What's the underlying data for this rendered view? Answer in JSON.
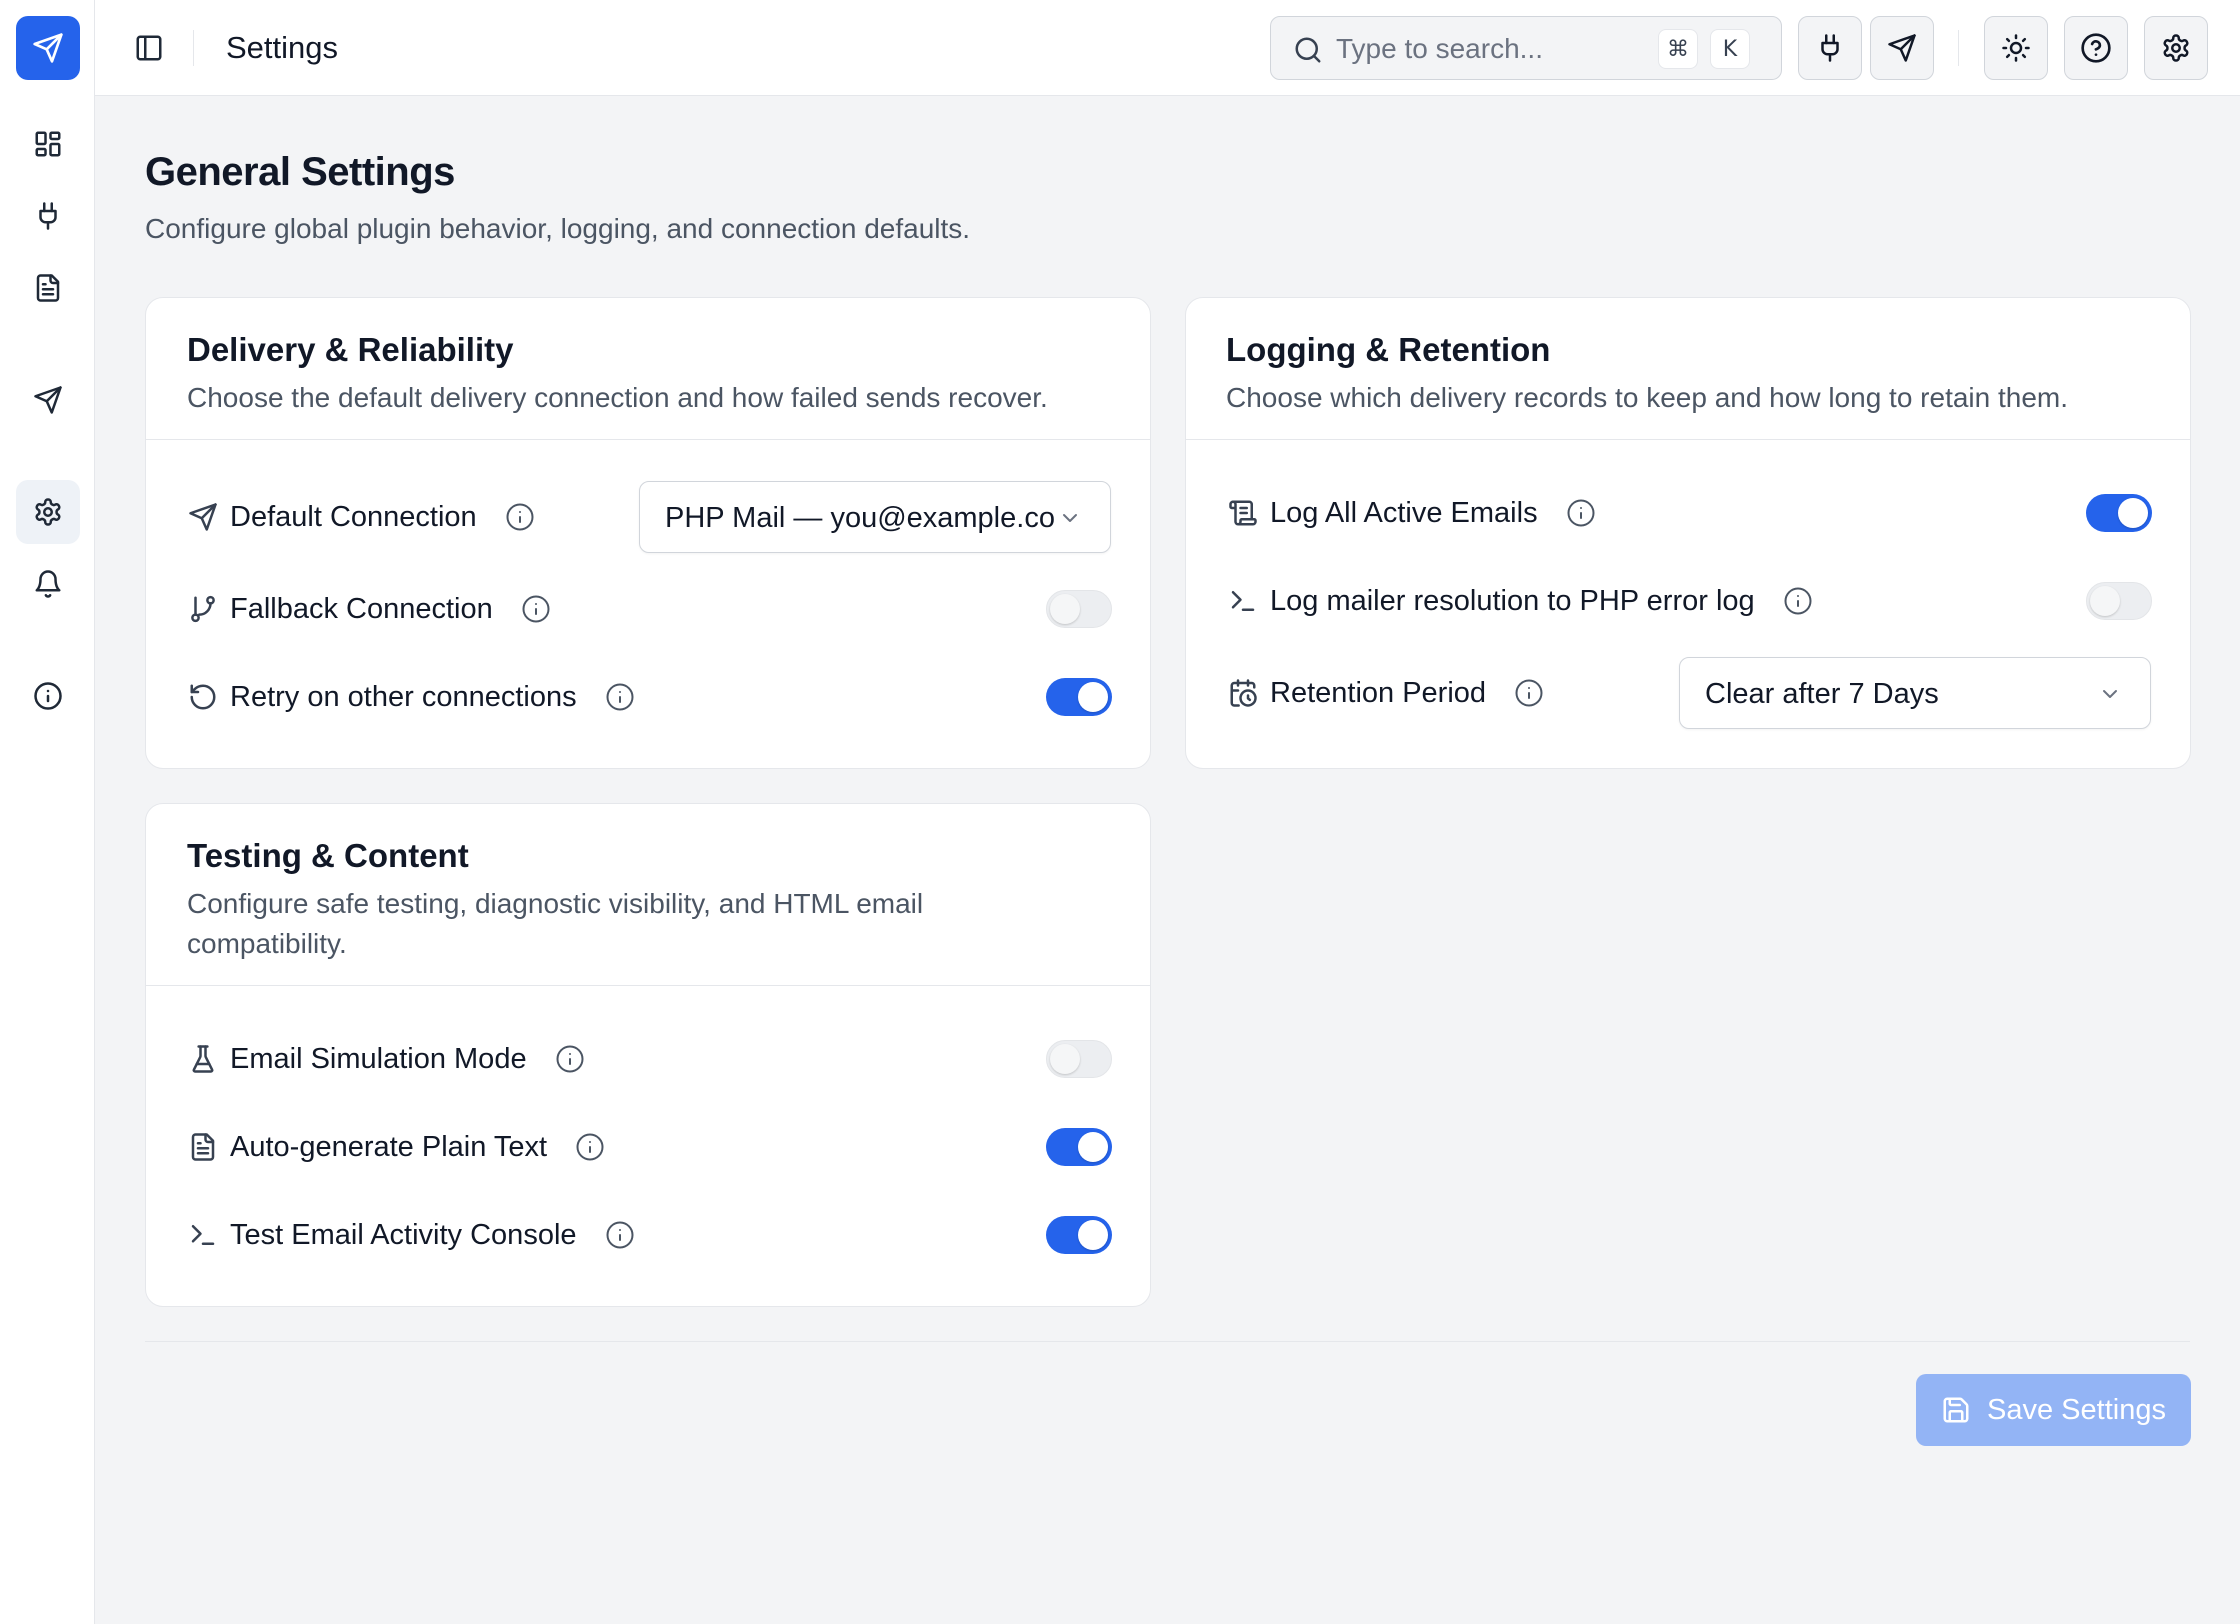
{
  "header": {
    "title": "Settings",
    "search": {
      "placeholder": "Type to search...",
      "shortcut_mod": "⌘",
      "shortcut_key": "K"
    }
  },
  "sidebar": {
    "items": [
      {
        "icon": "dashboard-icon",
        "active": false
      },
      {
        "icon": "plug-icon",
        "active": false
      },
      {
        "icon": "file-text-icon",
        "active": false
      },
      {
        "icon": "send-icon",
        "active": false
      },
      {
        "icon": "gear-icon",
        "active": true
      },
      {
        "icon": "bell-icon",
        "active": false
      },
      {
        "icon": "info-icon",
        "active": false
      }
    ]
  },
  "page": {
    "title": "General Settings",
    "subtitle": "Configure global plugin behavior, logging, and connection defaults."
  },
  "cards": {
    "delivery": {
      "title": "Delivery & Reliability",
      "description": "Choose the default delivery connection and how failed sends recover.",
      "default_connection": {
        "label": "Default Connection",
        "value": "PHP Mail — you@example.co"
      },
      "fallback_connection": {
        "label": "Fallback Connection",
        "enabled": false
      },
      "retry": {
        "label": "Retry on other connections",
        "enabled": true
      }
    },
    "logging": {
      "title": "Logging & Retention",
      "description": "Choose which delivery records to keep and how long to retain them.",
      "log_all": {
        "label": "Log All Active Emails",
        "enabled": true
      },
      "log_resolution": {
        "label": "Log mailer resolution to PHP error log",
        "enabled": false
      },
      "retention": {
        "label": "Retention Period",
        "value": "Clear after 7 Days"
      }
    },
    "testing": {
      "title": "Testing & Content",
      "description_line1": "Configure safe testing, diagnostic visibility, and HTML email",
      "description_line2": "compatibility.",
      "simulation": {
        "label": "Email Simulation Mode",
        "enabled": false
      },
      "plain_text": {
        "label": "Auto-generate Plain Text",
        "enabled": true
      },
      "console": {
        "label": "Test Email Activity Console",
        "enabled": true
      }
    }
  },
  "actions": {
    "save_label": "Save Settings"
  },
  "colors": {
    "accent": "#2563eb",
    "save_disabled": "#93b4f5",
    "background": "#f3f4f6"
  }
}
